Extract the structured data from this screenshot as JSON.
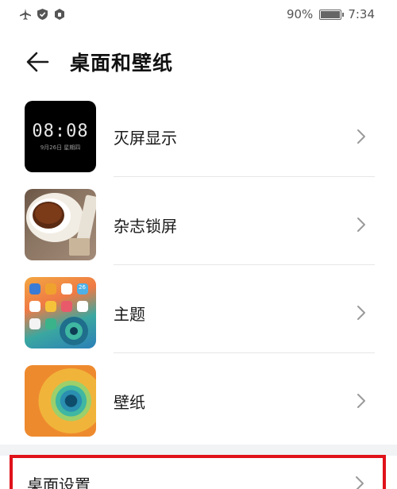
{
  "status_bar": {
    "battery_text": "90%",
    "battery_level": 0.9,
    "time": "7:34",
    "icons": [
      "airplane-icon",
      "shield-check-icon",
      "vpn-key-icon"
    ]
  },
  "header": {
    "back_icon": "arrow-left-icon",
    "title": "桌面和壁纸"
  },
  "items": [
    {
      "label": "灭屏显示",
      "thumb_time": "08:08",
      "thumb_date": "9月26日 星期四"
    },
    {
      "label": "杂志锁屏"
    },
    {
      "label": "主题",
      "thumb_badge": "26"
    },
    {
      "label": "壁纸"
    }
  ],
  "settings": {
    "label": "桌面设置",
    "highlight_color": "#e0121a"
  }
}
